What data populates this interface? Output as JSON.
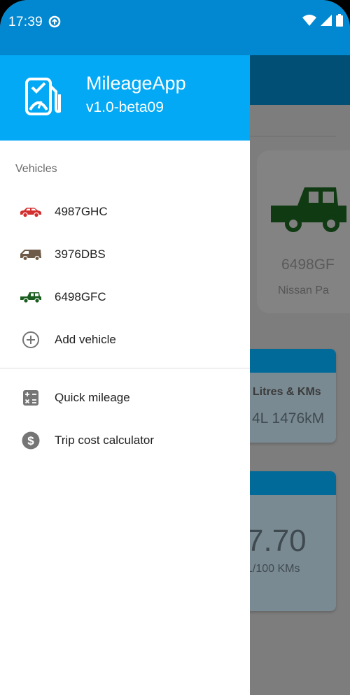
{
  "status_bar": {
    "time": "17:39"
  },
  "drawer": {
    "header": {
      "app_name": "MileageApp",
      "version": "v1.0-beta09",
      "logo_icon": "fuel-pump-icon",
      "background_color": "#03a9f4"
    },
    "vehicles_title": "Vehicles",
    "vehicles": [
      {
        "label": "4987GHC",
        "icon": "car-sedan-icon",
        "color": "#d32f2f"
      },
      {
        "label": "3976DBS",
        "icon": "van-icon",
        "color": "#6d5a48"
      },
      {
        "label": "6498GFC",
        "icon": "suv-icon",
        "color": "#1b5e20"
      }
    ],
    "add_vehicle": {
      "label": "Add vehicle",
      "icon": "add-circle-icon"
    },
    "tools": [
      {
        "label": "Quick mileage",
        "icon": "calculator-icon"
      },
      {
        "label": "Trip cost calculator",
        "icon": "dollar-circle-icon"
      }
    ]
  },
  "background": {
    "vehicle_plate": "6498GF",
    "vehicle_model": "Nissan Pa",
    "panel_title": "l Litres & KMs",
    "panel_values": "4L  1476kM",
    "consumption_value": "7.70",
    "consumption_unit": "L/100 KMs"
  }
}
